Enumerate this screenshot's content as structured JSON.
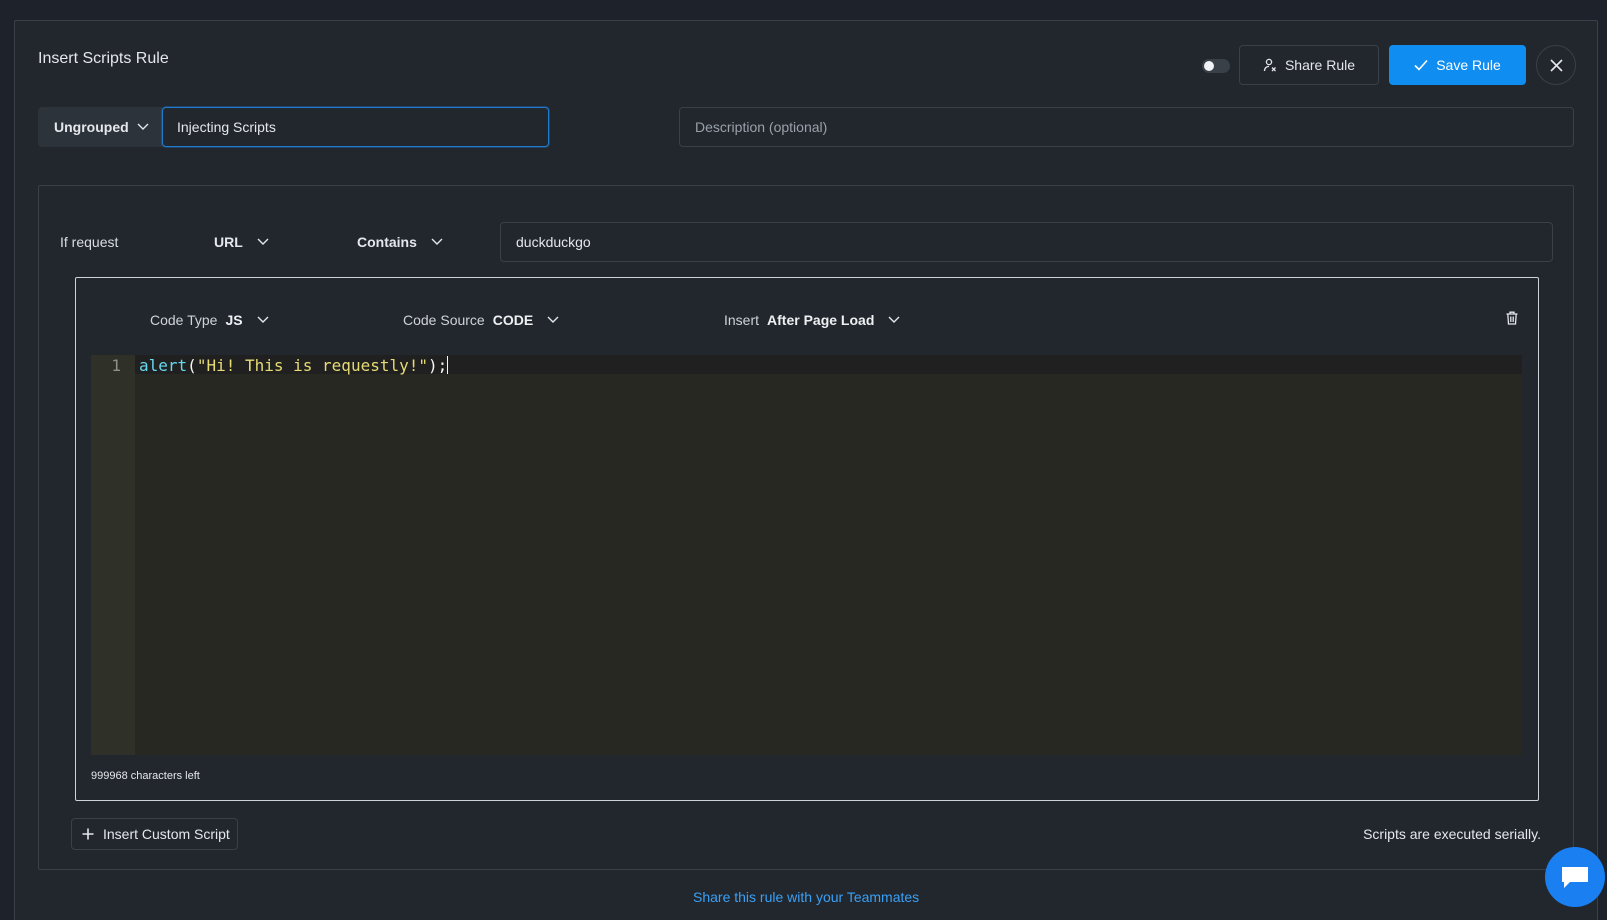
{
  "header": {
    "title": "Insert Scripts Rule",
    "status_toggle": "off",
    "share_label": "Share Rule",
    "save_label": "Save Rule"
  },
  "rule": {
    "group": "Ungrouped",
    "name_value": "Injecting Scripts",
    "description_placeholder": "Description (optional)",
    "description_value": ""
  },
  "condition": {
    "label": "If request",
    "field": "URL",
    "operator": "Contains",
    "value": "duckduckgo"
  },
  "script": {
    "code_type_label": "Code Type",
    "code_type_value": "JS",
    "code_source_label": "Code Source",
    "code_source_value": "CODE",
    "insert_label": "Insert",
    "insert_value": "After Page Load",
    "line_number": "1",
    "code_fn": "alert",
    "code_open": "(",
    "code_string": "\"Hi! This is requestly!\"",
    "code_close": ");",
    "chars_left": "999968 characters left"
  },
  "footer": {
    "insert_custom_label": "Insert Custom Script",
    "serial_note": "Scripts are executed serially.",
    "share_link": "Share this rule with your Teammates"
  },
  "colors": {
    "accent": "#0f8df0",
    "link": "#3aa0f5",
    "background": "#1e232b",
    "panel": "#22272e",
    "editor_bg": "#272822"
  },
  "icons": [
    "share-user-icon",
    "check-icon",
    "close-icon",
    "chevron-down-icon",
    "trash-icon",
    "plus-icon",
    "chat-icon"
  ]
}
